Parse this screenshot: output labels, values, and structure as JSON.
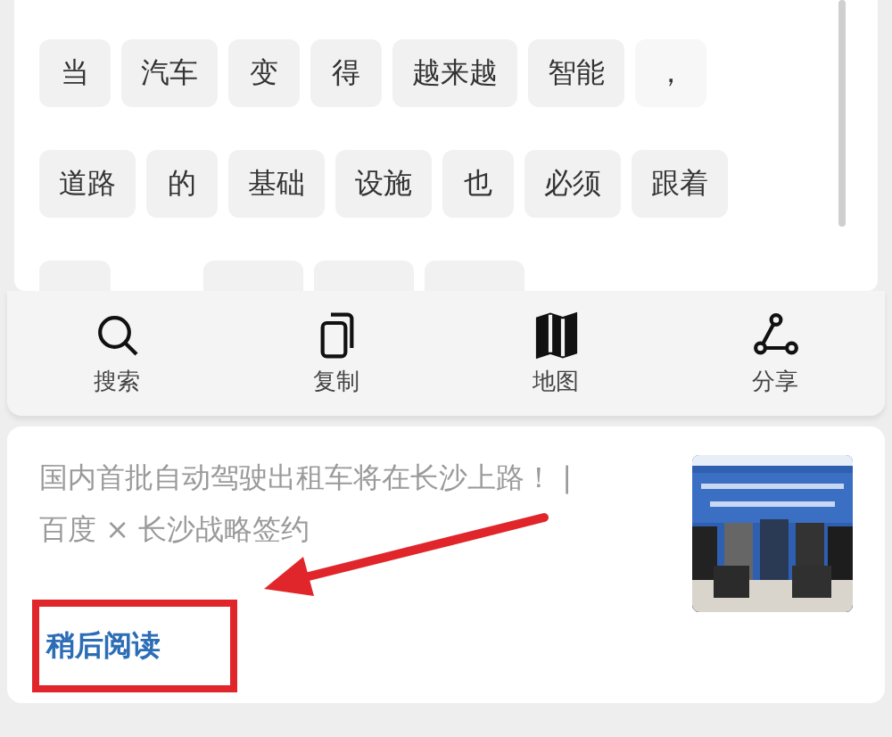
{
  "word_rows": [
    [
      {
        "kind": "word",
        "text": "当"
      },
      {
        "kind": "word",
        "text": "汽车"
      },
      {
        "kind": "word",
        "text": "变"
      },
      {
        "kind": "word",
        "text": "得"
      },
      {
        "kind": "word",
        "text": "越来越"
      },
      {
        "kind": "word",
        "text": "智能"
      },
      {
        "kind": "punct",
        "text": "，"
      }
    ],
    [
      {
        "kind": "word",
        "text": "道路"
      },
      {
        "kind": "word",
        "text": "的"
      },
      {
        "kind": "word",
        "text": "基础"
      },
      {
        "kind": "word",
        "text": "设施"
      },
      {
        "kind": "word",
        "text": "也"
      },
      {
        "kind": "word",
        "text": "必须"
      },
      {
        "kind": "word",
        "text": "跟着"
      }
    ],
    [
      {
        "kind": "hidden"
      },
      {
        "kind": "hidden"
      },
      {
        "kind": "hidden"
      },
      {
        "kind": "hidden"
      }
    ]
  ],
  "actions": [
    {
      "kind": "search",
      "label": "搜索"
    },
    {
      "kind": "copy",
      "label": "复制"
    },
    {
      "kind": "map",
      "label": "地图"
    },
    {
      "kind": "share",
      "label": "分享"
    }
  ],
  "article": {
    "title_lines": [
      "国内首批自动驾驶出租车将在长沙上路！ |",
      "百度 × 长沙战略签约"
    ],
    "read_later": "稍后阅读",
    "thumbnail": {
      "kind": "picture"
    }
  }
}
